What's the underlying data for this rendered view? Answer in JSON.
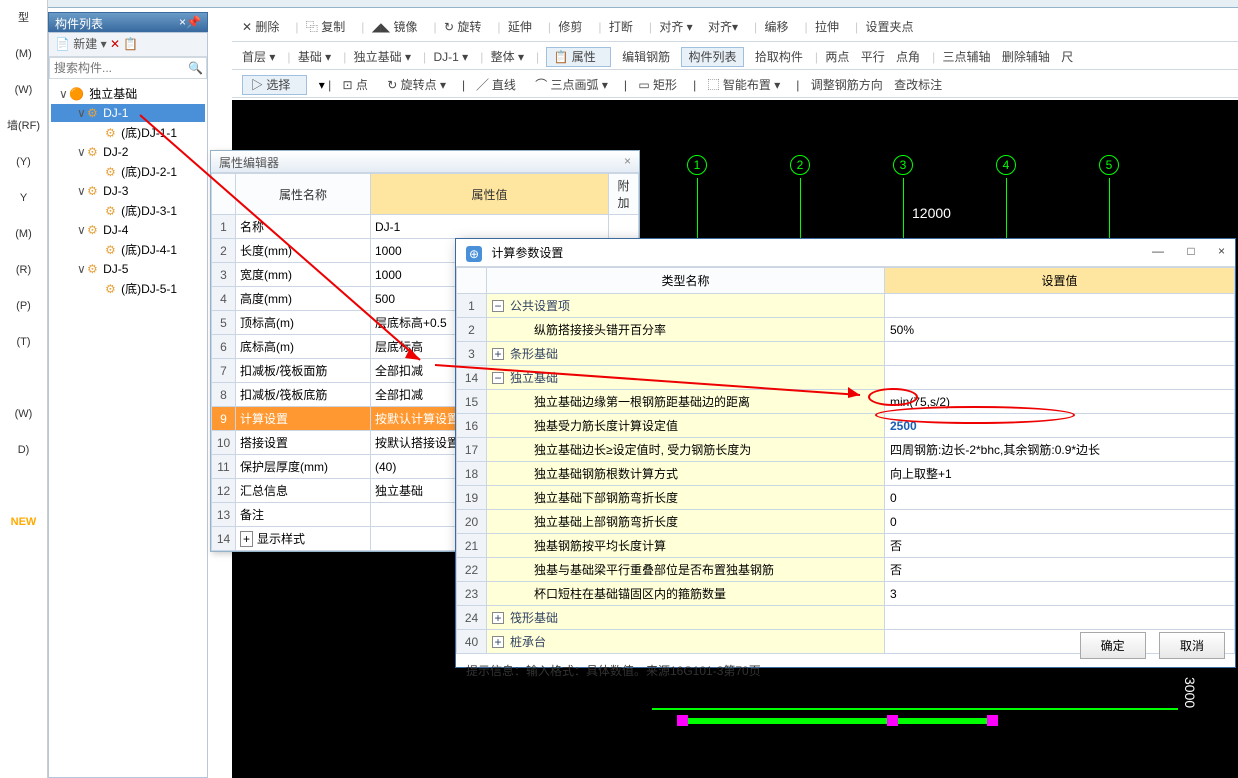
{
  "panel": {
    "title": "构件列表",
    "pin": "📌",
    "close": "×"
  },
  "newBtn": "新建",
  "copyIcon": "📋",
  "searchPlaceholder": "搜索构件...",
  "tree": [
    {
      "lvl": 1,
      "exp": "∨",
      "icon": "🟠",
      "label": "独立基础"
    },
    {
      "lvl": 2,
      "exp": "∨",
      "icon": "⚙",
      "label": "DJ-1",
      "sel": true
    },
    {
      "lvl": 3,
      "exp": "",
      "icon": "⚙",
      "label": "(底)DJ-1-1"
    },
    {
      "lvl": 2,
      "exp": "∨",
      "icon": "⚙",
      "label": "DJ-2"
    },
    {
      "lvl": 3,
      "exp": "",
      "icon": "⚙",
      "label": "(底)DJ-2-1"
    },
    {
      "lvl": 2,
      "exp": "∨",
      "icon": "⚙",
      "label": "DJ-3"
    },
    {
      "lvl": 3,
      "exp": "",
      "icon": "⚙",
      "label": "(底)DJ-3-1"
    },
    {
      "lvl": 2,
      "exp": "∨",
      "icon": "⚙",
      "label": "DJ-4"
    },
    {
      "lvl": 3,
      "exp": "",
      "icon": "⚙",
      "label": "(底)DJ-4-1"
    },
    {
      "lvl": 2,
      "exp": "∨",
      "icon": "⚙",
      "label": "DJ-5"
    },
    {
      "lvl": 3,
      "exp": "",
      "icon": "⚙",
      "label": "(底)DJ-5-1"
    }
  ],
  "tb1": [
    "删除",
    "复制",
    "镜像",
    "旋转",
    "延伸",
    "修剪",
    "打断",
    "对齐 ▾",
    "对齐▾",
    "编移",
    "拉伸",
    "设置夹点"
  ],
  "tb2": {
    "floor": "首层 ▾",
    "cat": "基础 ▾",
    "type": "独立基础 ▾",
    "name": "DJ-1 ▾",
    "mode": "整体 ▾",
    "attr": "属性",
    "rebar": "编辑钢筋",
    "list": "构件列表",
    "pick": "拾取构件",
    "two": "两点",
    "parallel": "平行",
    "pt": "点角",
    "three": "三点辅轴",
    "del": "删除辅轴",
    "rule": "尺"
  },
  "tb3": {
    "select": "选择",
    "point": "点",
    "rotatePt": "旋转点 ▾",
    "line": "直线",
    "arc": "三点画弧 ▾",
    "rect": "矩形",
    "smart": "智能布置 ▾",
    "adjust": "调整钢筋方向",
    "check": "查改标注"
  },
  "gridNums": [
    "1",
    "2",
    "3",
    "4",
    "5"
  ],
  "dim": "12000",
  "pe": {
    "title": "属性编辑器",
    "cols": [
      "属性名称",
      "属性值",
      "附加"
    ],
    "rows": [
      {
        "n": "1",
        "name": "名称",
        "val": "DJ-1"
      },
      {
        "n": "2",
        "name": "长度(mm)",
        "val": "1000"
      },
      {
        "n": "3",
        "name": "宽度(mm)",
        "val": "1000"
      },
      {
        "n": "4",
        "name": "高度(mm)",
        "val": "500"
      },
      {
        "n": "5",
        "name": "顶标高(m)",
        "val": "层底标高+0.5"
      },
      {
        "n": "6",
        "name": "底标高(m)",
        "val": "层底标高"
      },
      {
        "n": "7",
        "name": "扣减板/筏板面筋",
        "val": "全部扣减"
      },
      {
        "n": "8",
        "name": "扣减板/筏板底筋",
        "val": "全部扣减"
      },
      {
        "n": "9",
        "name": "计算设置",
        "val": "按默认计算设置计算",
        "sel": true
      },
      {
        "n": "10",
        "name": "搭接设置",
        "val": "按默认搭接设置计算"
      },
      {
        "n": "11",
        "name": "保护层厚度(mm)",
        "val": "(40)"
      },
      {
        "n": "12",
        "name": "汇总信息",
        "val": "独立基础"
      },
      {
        "n": "13",
        "name": "备注",
        "val": ""
      },
      {
        "n": "14",
        "name": "显示样式",
        "val": "",
        "exp": "+"
      }
    ]
  },
  "cd": {
    "title": "计算参数设置",
    "cols": [
      "类型名称",
      "设置值"
    ],
    "rows": [
      {
        "n": "1",
        "exp": "−",
        "name": "公共设置项",
        "grp": true
      },
      {
        "n": "2",
        "name": "纵筋搭接接头错开百分率",
        "val": "50%"
      },
      {
        "n": "3",
        "exp": "+",
        "name": "条形基础",
        "grp": true
      },
      {
        "n": "14",
        "exp": "−",
        "name": "独立基础",
        "grp": true
      },
      {
        "n": "15",
        "name": "独立基础边缘第一根钢筋距基础边的距离",
        "val": "min(75,s/2)"
      },
      {
        "n": "16",
        "name": "独基受力筋长度计算设定值",
        "val": "2500",
        "sel": true
      },
      {
        "n": "17",
        "name": "独立基础边长≥设定值时, 受力钢筋长度为",
        "val": "四周钢筋:边长-2*bhc,其余钢筋:0.9*边长"
      },
      {
        "n": "18",
        "name": "独立基础钢筋根数计算方式",
        "val": "向上取整+1"
      },
      {
        "n": "19",
        "name": "独立基础下部钢筋弯折长度",
        "val": "0"
      },
      {
        "n": "20",
        "name": "独立基础上部钢筋弯折长度",
        "val": "0"
      },
      {
        "n": "21",
        "name": "独基钢筋按平均长度计算",
        "val": "否"
      },
      {
        "n": "22",
        "name": "独基与基础梁平行重叠部位是否布置独基钢筋",
        "val": "否"
      },
      {
        "n": "23",
        "name": "杯口短柱在基础锚固区内的箍筋数量",
        "val": "3"
      },
      {
        "n": "24",
        "exp": "+",
        "name": "筏形基础",
        "grp": true
      },
      {
        "n": "40",
        "exp": "+",
        "name": "桩承台",
        "grp": true
      }
    ],
    "hint": "提示信息：输入格式：具体数值。来源16G101-3第70页",
    "ok": "确定",
    "cancel": "取消"
  },
  "leftLabels": [
    "型",
    "(M)",
    "(W)",
    "墙(RF)",
    "(Y)",
    "Y",
    "(M)",
    "(R)",
    "(P)",
    "(T)",
    "",
    "(W)",
    "D)",
    "",
    "NEW"
  ],
  "bottomDim": "3000"
}
